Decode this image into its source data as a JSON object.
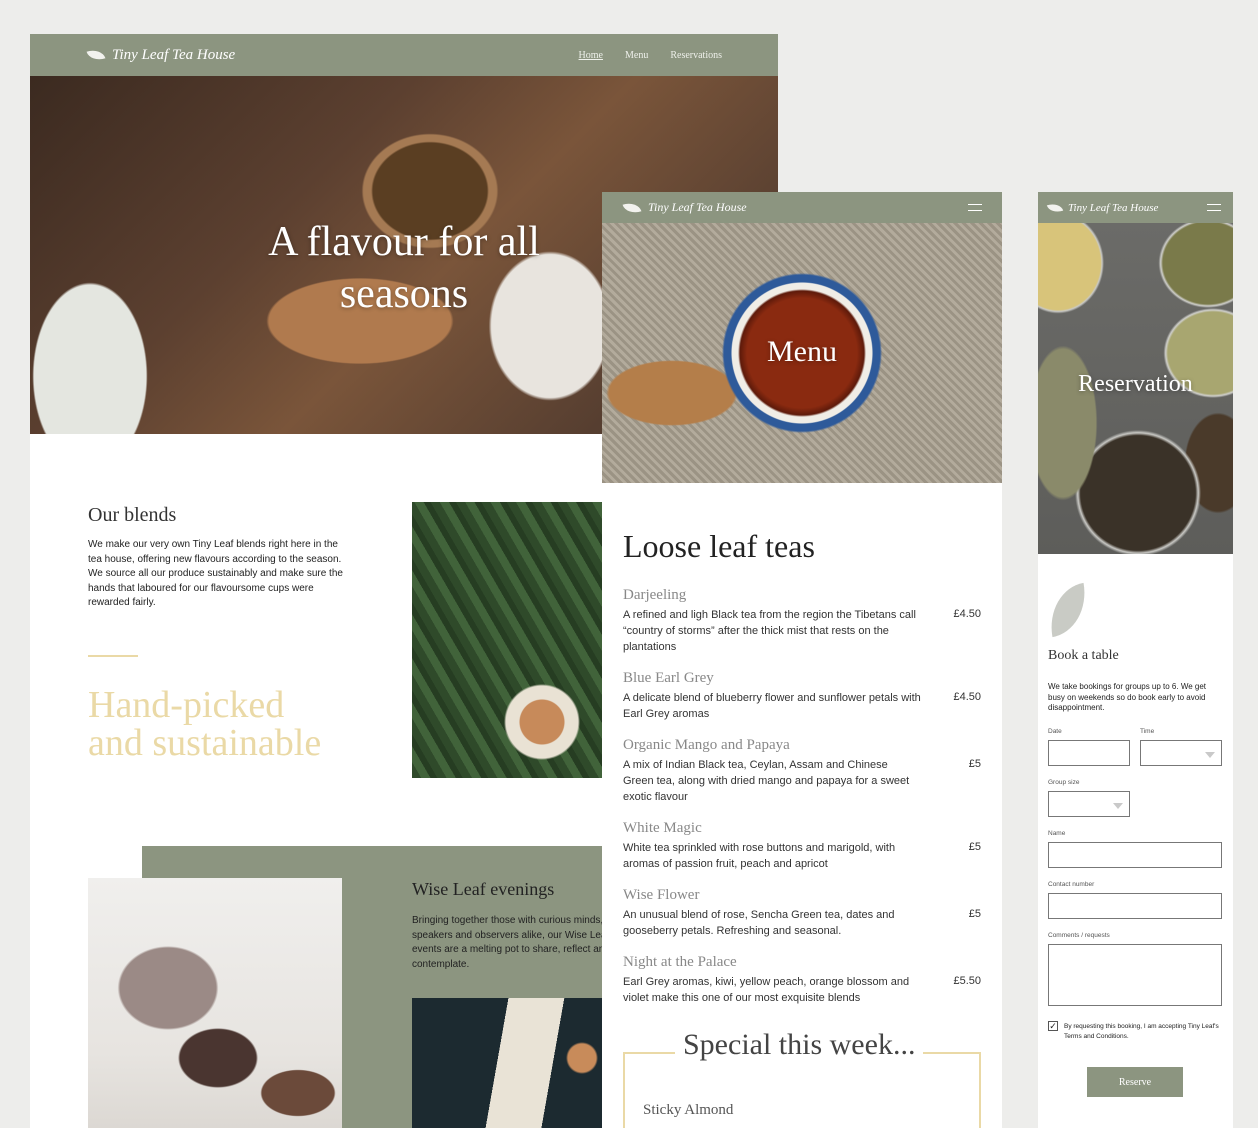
{
  "colors": {
    "olive": "#8c9580",
    "gold": "#ead9a6",
    "background": "#ededeb"
  },
  "brand": "Tiny Leaf Tea House",
  "desktop": {
    "nav": [
      "Home",
      "Menu",
      "Reservations"
    ],
    "hero_title": "A flavour for all seasons",
    "blends_title": "Our blends",
    "blends_text": "We make our very own Tiny Leaf blends right here in the tea house, offering new flavours according to the season. We source all our produce sustainably and make sure the hands that laboured for our flavoursome cups were rewarded fairly.",
    "handpicked_line1": "Hand-picked",
    "handpicked_line2": "and sustainable",
    "wise_title": "Wise Leaf evenings",
    "wise_text": "Bringing together those with curious minds, speakers and observers alike, our Wise Leaf events are a melting pot to share, reflect and contemplate."
  },
  "tablet": {
    "hero_title": "Menu",
    "section_title": "Loose leaf teas",
    "items": [
      {
        "name": "Darjeeling",
        "desc": "A refined and ligh Black tea from the region the Tibetans call “country of storms” after the thick mist that rests on the plantations",
        "price": "£4.50"
      },
      {
        "name": "Blue Earl Grey",
        "desc": "A delicate blend of blueberry flower and sunflower petals with Earl Grey aromas",
        "price": "£4.50"
      },
      {
        "name": "Organic Mango and Papaya",
        "desc": "A mix of Indian Black tea, Ceylan, Assam and Chinese Green tea, along with dried mango and papaya for a sweet exotic flavour",
        "price": "£5"
      },
      {
        "name": "White Magic",
        "desc": "White tea sprinkled with rose buttons and marigold, with aromas of passion fruit, peach and apricot",
        "price": "£5"
      },
      {
        "name": "Wise Flower",
        "desc": "An unusual blend of rose, Sencha Green tea, dates and gooseberry petals. Refreshing and seasonal.",
        "price": "£5"
      },
      {
        "name": "Night at the Palace",
        "desc": "Earl Grey aromas, kiwi, yellow peach, orange blossom and violet make this one of our most exquisite blends",
        "price": "£5.50"
      }
    ],
    "special_title": "Special this week...",
    "special_item": "Sticky Almond"
  },
  "mobile": {
    "hero_title": "Reservation",
    "book_title": "Book a table",
    "book_text": "We take bookings for groups up to 6. We get busy on weekends so do book early to avoid disappointment.",
    "labels": {
      "date": "Date",
      "time": "Time",
      "group": "Group size",
      "name": "Name",
      "contact": "Contact number",
      "comments": "Comments / requests"
    },
    "terms": "By requesting this booking, I am accepting Tiny Leaf's Terms and Conditions.",
    "terms_checked": true,
    "reserve_label": "Reserve"
  }
}
